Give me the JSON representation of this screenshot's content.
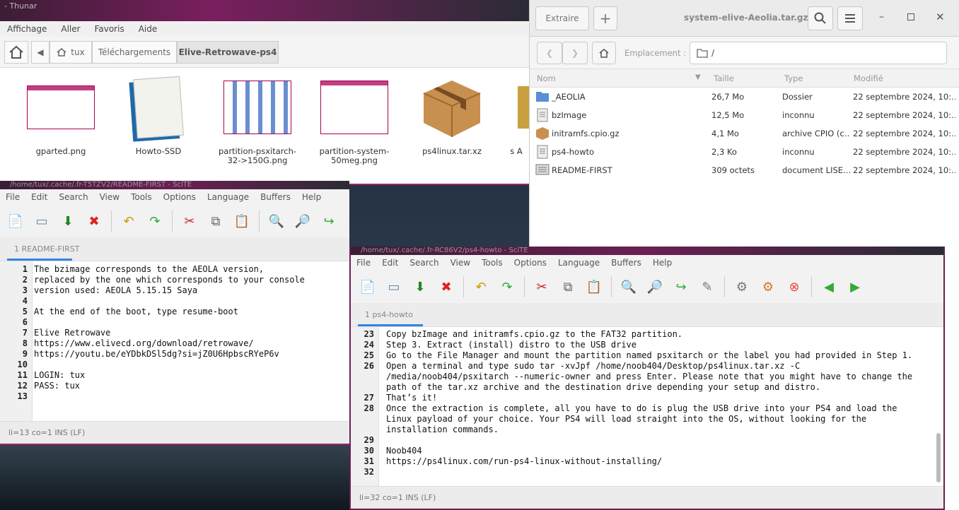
{
  "thunar": {
    "title": "- Thunar",
    "menu": [
      "Affichage",
      "Aller",
      "Favoris",
      "Aide"
    ],
    "crumbs": [
      "tux",
      "Téléchargements",
      "Elive-Retrowave-ps4"
    ],
    "files": [
      {
        "name": "gparted.png"
      },
      {
        "name": "Howto-SSD"
      },
      {
        "name": "partition-psxitarch-32->150G.png"
      },
      {
        "name": "partition-system-50meg.png"
      },
      {
        "name": "ps4linux.tar.xz"
      },
      {
        "name": "s A"
      }
    ]
  },
  "archive": {
    "extract_label": "Extraire",
    "title": "system-elive-Aeolia.tar.gz",
    "location_label": "Emplacement :",
    "location_value": "/",
    "columns": {
      "name": "Nom",
      "size": "Taille",
      "type": "Type",
      "modified": "Modifié"
    },
    "rows": [
      {
        "name": "_AEOLIA",
        "size": "26,7 Mo",
        "type": "Dossier",
        "modified": "22 septembre 2024, 10:…",
        "icon": "folder-icon"
      },
      {
        "name": "bzImage",
        "size": "12,5 Mo",
        "type": "inconnu",
        "modified": "22 septembre 2024, 10:…",
        "icon": "file-icon"
      },
      {
        "name": "initramfs.cpio.gz",
        "size": "4,1 Mo",
        "type": "archive CPIO (c…",
        "modified": "22 septembre 2024, 10:…",
        "icon": "package-icon"
      },
      {
        "name": "ps4-howto",
        "size": "2,3 Ko",
        "type": "inconnu",
        "modified": "22 septembre 2024, 10:…",
        "icon": "file-icon"
      },
      {
        "name": "README-FIRST",
        "size": "309 octets",
        "type": "document LISE…",
        "modified": "22 septembre 2024, 10:…",
        "icon": "text-file-icon"
      }
    ]
  },
  "scite1": {
    "title": "/home/tux/.cache/.fr-T5TZV2/README-FIRST - SciTE",
    "menu": [
      "File",
      "Edit",
      "Search",
      "View",
      "Tools",
      "Options",
      "Language",
      "Buffers",
      "Help"
    ],
    "tab": "1 README-FIRST",
    "lines": [
      {
        "n": "1",
        "t": "The bzimage corresponds to the AEOLA version,"
      },
      {
        "n": "2",
        "t": "replaced by the one which corresponds to your console"
      },
      {
        "n": "3",
        "t": "version used: AEOLA 5.15.15 Saya"
      },
      {
        "n": "4",
        "t": ""
      },
      {
        "n": "5",
        "t": "At the end of the boot, type resume-boot"
      },
      {
        "n": "6",
        "t": ""
      },
      {
        "n": "7",
        "t": "Elive Retrowave"
      },
      {
        "n": "8",
        "t": "https://www.elivecd.org/download/retrowave/"
      },
      {
        "n": "9",
        "t": "https://youtu.be/eYDbkDSl5dg?si=jZ0U6HpbscRYeP6v"
      },
      {
        "n": "10",
        "t": ""
      },
      {
        "n": "11",
        "t": "LOGIN: tux"
      },
      {
        "n": "12",
        "t": "PASS: tux"
      },
      {
        "n": "13",
        "t": ""
      }
    ],
    "status": "li=13 co=1 INS (LF)"
  },
  "scite2": {
    "title": "/home/tux/.cache/.fr-RC86V2/ps4-howto - SciTE",
    "menu": [
      "File",
      "Edit",
      "Search",
      "View",
      "Tools",
      "Options",
      "Language",
      "Buffers",
      "Help"
    ],
    "tab": "1 ps4-howto",
    "lines": [
      {
        "n": "23",
        "t": "Copy bzImage and initramfs.cpio.gz to the FAT32 partition."
      },
      {
        "n": "24",
        "t": "Step 3. Extract (install) distro to the USB drive"
      },
      {
        "n": "25",
        "t": "Go to the File Manager and mount the partition named psxitarch or the label you had provided in Step 1."
      },
      {
        "n": "26",
        "t": "Open a terminal and type sudo tar -xvJpf /home/noob404/Desktop/ps4linux.tar.xz -C"
      },
      {
        "n": "",
        "t": "/media/noob404/psxitarch --numeric-owner and press Enter. Please note that you might have to change the"
      },
      {
        "n": "",
        "t": "path of the tar.xz archive and the destination drive depending your setup and distro."
      },
      {
        "n": "27",
        "t": "That’s it!"
      },
      {
        "n": "28",
        "t": "Once the extraction is complete, all you have to do is plug the USB drive into your PS4 and load the"
      },
      {
        "n": "",
        "t": "Linux payload of your choice. Your PS4 will load straight into the OS, without looking for the"
      },
      {
        "n": "",
        "t": "installation commands."
      },
      {
        "n": "29",
        "t": ""
      },
      {
        "n": "30",
        "t": "Noob404"
      },
      {
        "n": "31",
        "t": "https://ps4linux.com/run-ps4-linux-without-installing/"
      },
      {
        "n": "32",
        "t": ""
      }
    ],
    "status": "li=32 co=1 INS (LF)"
  }
}
